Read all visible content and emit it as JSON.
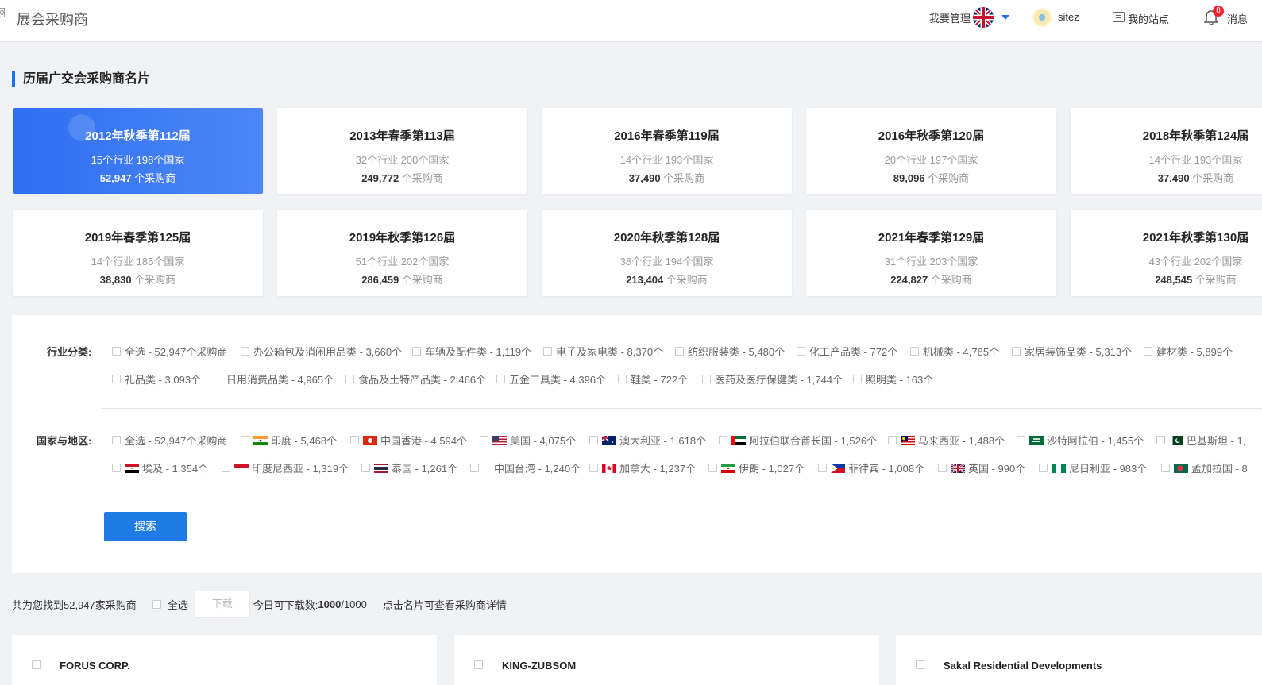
{
  "header": {
    "edge_text": "0",
    "app_title": "展会采购商",
    "manage_label": "我要管理",
    "language_icon": "uk-flag-icon",
    "username": "sitez",
    "my_site_label": "我的站点",
    "notification_count": "8",
    "messages_label": "消息"
  },
  "section": {
    "title": "历届广交会采购商名片"
  },
  "sessions": [
    {
      "title": "2012年秋季第112届",
      "stats": "15个行业 198个国家",
      "count": "52,947",
      "unit": " 个采购商",
      "active": true
    },
    {
      "title": "2013年春季第113届",
      "stats": "32个行业 200个国家",
      "count": "249,772",
      "unit": " 个采购商"
    },
    {
      "title": "2016年春季第119届",
      "stats": "14个行业 193个国家",
      "count": "37,490",
      "unit": " 个采购商"
    },
    {
      "title": "2016年秋季第120届",
      "stats": "20个行业 197个国家",
      "count": "89,096",
      "unit": " 个采购商"
    },
    {
      "title": "2018年秋季第124届",
      "stats": "14个行业 193个国家",
      "count": "37,490",
      "unit": " 个采购商"
    },
    {
      "title": "2019年春季第125届",
      "stats": "14个行业 185个国家",
      "count": "38,830",
      "unit": " 个采购商"
    },
    {
      "title": "2019年秋季第126届",
      "stats": "51个行业 202个国家",
      "count": "286,459",
      "unit": " 个采购商"
    },
    {
      "title": "2020年秋季第128届",
      "stats": "38个行业 194个国家",
      "count": "213,404",
      "unit": " 个采购商"
    },
    {
      "title": "2021年春季第129届",
      "stats": "31个行业 203个国家",
      "count": "224,827",
      "unit": " 个采购商"
    },
    {
      "title": "2021年秋季第130届",
      "stats": "43个行业 202个国家",
      "count": "248,545",
      "unit": " 个采购商"
    }
  ],
  "filters": {
    "industry_label": "行业分类:",
    "industries_row1": [
      "全选 - 52,947个采购商",
      "办公箱包及消闲用品类 - 3,660个",
      "车辆及配件类 - 1,119个",
      "电子及家电类 - 8,370个",
      "纺织服装类 - 5,480个",
      "化工产品类 - 772个",
      "机械类 - 4,785个",
      "家居装饰品类 - 5,313个",
      "建材类 - 5,899个"
    ],
    "industries_row2": [
      "礼品类 - 3,093个",
      "日用消费品类 - 4,965个",
      "食品及土特产品类 - 2,466个",
      "五金工具类 - 4,396个",
      "鞋类 - 722个",
      "医药及医疗保健类 - 1,744个",
      "照明类 - 163个"
    ],
    "country_label": "国家与地区:",
    "countries_row1": [
      {
        "label": "全选 - 52,947个采购商",
        "flag": ""
      },
      {
        "label": "印度 - 5,468个",
        "flag": "india-flag-icon"
      },
      {
        "label": "中国香港 - 4,594个",
        "flag": "hong-kong-flag-icon"
      },
      {
        "label": "美国 - 4,075个",
        "flag": "usa-flag-icon"
      },
      {
        "label": "澳大利亚 - 1,618个",
        "flag": "australia-flag-icon"
      },
      {
        "label": "阿拉伯联合酋长国 - 1,526个",
        "flag": "uae-flag-icon"
      },
      {
        "label": "马来西亚 - 1,488个",
        "flag": "malaysia-flag-icon"
      },
      {
        "label": "沙特阿拉伯 - 1,455个",
        "flag": "saudi-arabia-flag-icon"
      },
      {
        "label": "巴基斯坦 - 1,",
        "flag": "pakistan-flag-icon"
      }
    ],
    "countries_row2": [
      {
        "label": "埃及 - 1,354个",
        "flag": "egypt-flag-icon"
      },
      {
        "label": "印度尼西亚 - 1,319个",
        "flag": "indonesia-flag-icon"
      },
      {
        "label": "泰国 - 1,261个",
        "flag": "thailand-flag-icon"
      },
      {
        "label": "中国台湾 - 1,240个",
        "flag": ""
      },
      {
        "label": "加拿大 - 1,237个",
        "flag": "canada-flag-icon"
      },
      {
        "label": "伊朗 - 1,027个",
        "flag": "iran-flag-icon"
      },
      {
        "label": "菲律宾 - 1,008个",
        "flag": "philippines-flag-icon"
      },
      {
        "label": "英国 - 990个",
        "flag": "uk-flag-icon"
      },
      {
        "label": "尼日利亚 - 983个",
        "flag": "nigeria-flag-icon"
      },
      {
        "label": "孟加拉国 - 8",
        "flag": "bangladesh-flag-icon"
      }
    ],
    "search_label": "搜索"
  },
  "results": {
    "found_text": "共为您找到52,947家采购商",
    "select_all": "全选",
    "download": "下载",
    "quota_prefix": "今日可下载数: ",
    "quota_used": "1000",
    "quota_total": "/1000",
    "hint": "点击名片可查看采购商详情"
  },
  "buyers": [
    "FORUS CORP.",
    "KING-ZUBSOM",
    "Sakal Residential Developments"
  ]
}
